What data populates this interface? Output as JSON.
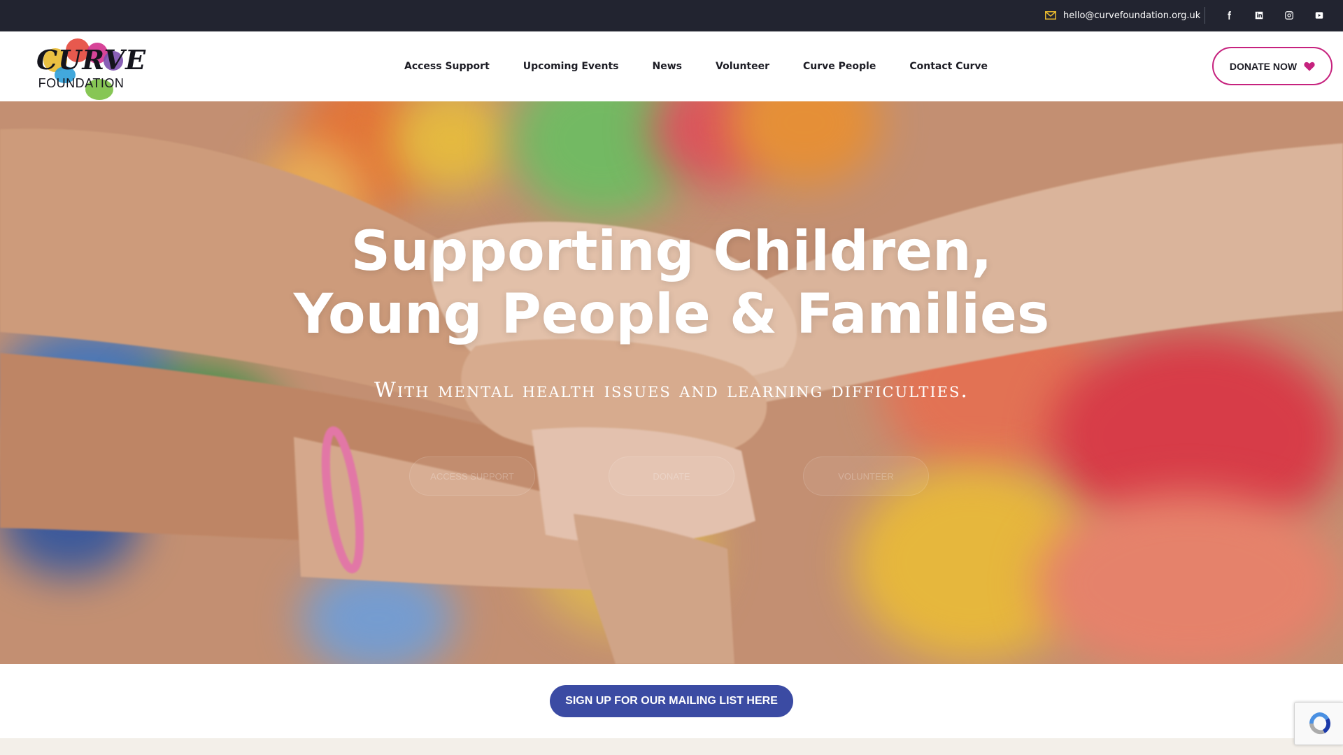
{
  "topbar": {
    "email": "hello@curvefoundation.org.uk",
    "social": [
      "facebook-icon",
      "linkedin-icon",
      "instagram-icon",
      "youtube-icon"
    ]
  },
  "logo": {
    "word_top": "CURVE",
    "word_bottom": "FOUNDATION"
  },
  "nav": {
    "items": [
      "Access Support",
      "Upcoming Events",
      "News",
      "Volunteer",
      "Curve People",
      "Contact Curve"
    ]
  },
  "header": {
    "donate_label": "DONATE NOW"
  },
  "hero": {
    "title_line1": "Supporting Children,",
    "title_line2": "Young People & Families",
    "subtitle": "With mental health issues and learning difficulties.",
    "buttons": [
      "ACCESS SUPPORT",
      "DONATE",
      "VOLUNTEER"
    ]
  },
  "mailing": {
    "button_label": "SIGN UP FOR OUR MAILING LIST HERE"
  },
  "colors": {
    "topbar": "#222430",
    "accent": "#c6227e",
    "mailing_button": "#3b4ba3"
  }
}
